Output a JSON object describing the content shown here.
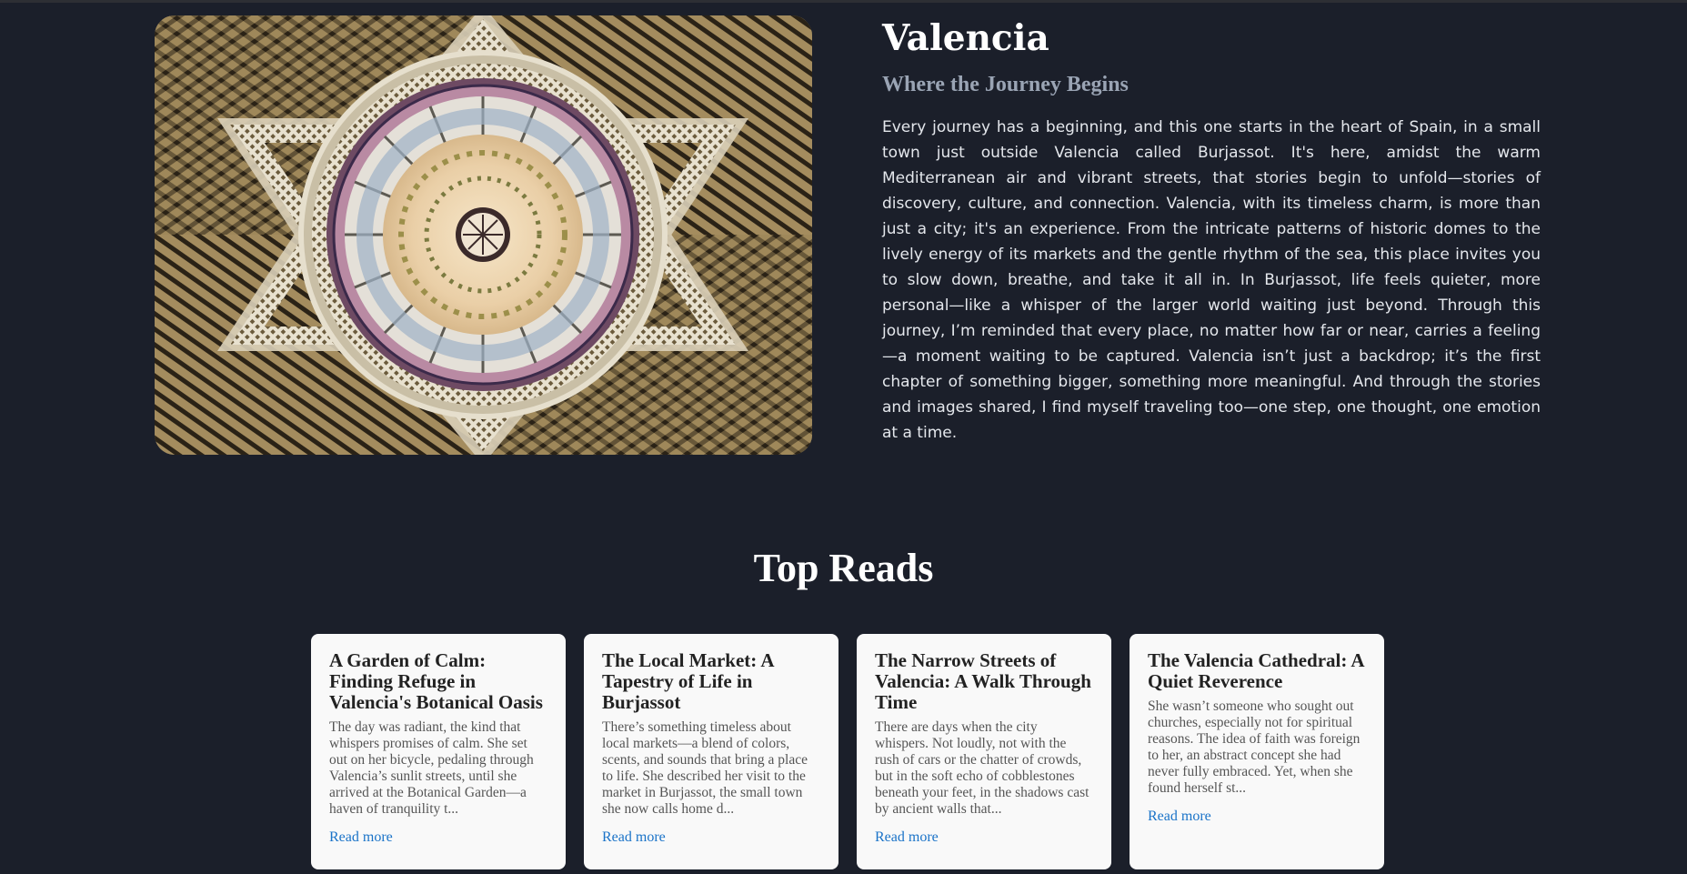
{
  "hero": {
    "image_alt": "Dome of Valencia's Mercado Central viewed from below",
    "title": "Valencia",
    "subtitle": "Where the Journey Begins",
    "body": "Every journey has a beginning, and this one starts in the heart of Spain, in a small town just outside Valencia called Burjassot. It's here, amidst the warm Mediterranean air and vibrant streets, that stories begin to unfold—stories of discovery, culture, and connection. Valencia, with its timeless charm, is more than just a city; it's an experience. From the intricate patterns of historic domes to the lively energy of its markets and the gentle rhythm of the sea, this place invites you to slow down, breathe, and take it all in. In Burjassot, life feels quieter, more personal—like a whisper of the larger world waiting just beyond. Through this journey, I’m reminded that every place, no matter how far or near, carries a feeling—a moment waiting to be captured. Valencia isn’t just a backdrop; it’s the first chapter of something bigger, something more meaningful. And through the stories and images shared, I find myself traveling too—one step, one thought, one emotion at a time."
  },
  "top_reads": {
    "title": "Top Reads",
    "cards": [
      {
        "title": "A Garden of Calm: Finding Refuge in Valencia's Botanical Oasis",
        "excerpt": "The day was radiant, the kind that whispers promises of calm. She set out on her bicycle, pedaling through Valencia’s sunlit streets, until she arrived at the Botanical Garden—a haven of tranquility t...",
        "link": "Read more"
      },
      {
        "title": "The Local Market: A Tapestry of Life in Burjassot",
        "excerpt": "There’s something timeless about local markets—a blend of colors, scents, and sounds that bring a place to life. She described her visit to the market in Burjassot, the small town she now calls home d...",
        "link": "Read more"
      },
      {
        "title": "The Narrow Streets of Valencia: A Walk Through Time",
        "excerpt": "There are days when the city whispers. Not loudly, not with the rush of cars or the chatter of crowds, but in the soft echo of cobblestones beneath your feet, in the shadows cast by ancient walls that...",
        "link": "Read more"
      },
      {
        "title": "The Valencia Cathedral: A Quiet Reverence",
        "excerpt": "She wasn’t someone who sought out churches, especially not for spiritual reasons. The idea of faith was foreign to her, an abstract concept she had never fully embraced. Yet, when she found herself st...",
        "link": "Read more"
      }
    ]
  },
  "colors": {
    "page_background": "#1b1f2a",
    "card_background": "#f9f9f9",
    "link": "#1a73c8",
    "subtitle": "#9aa4b4"
  }
}
